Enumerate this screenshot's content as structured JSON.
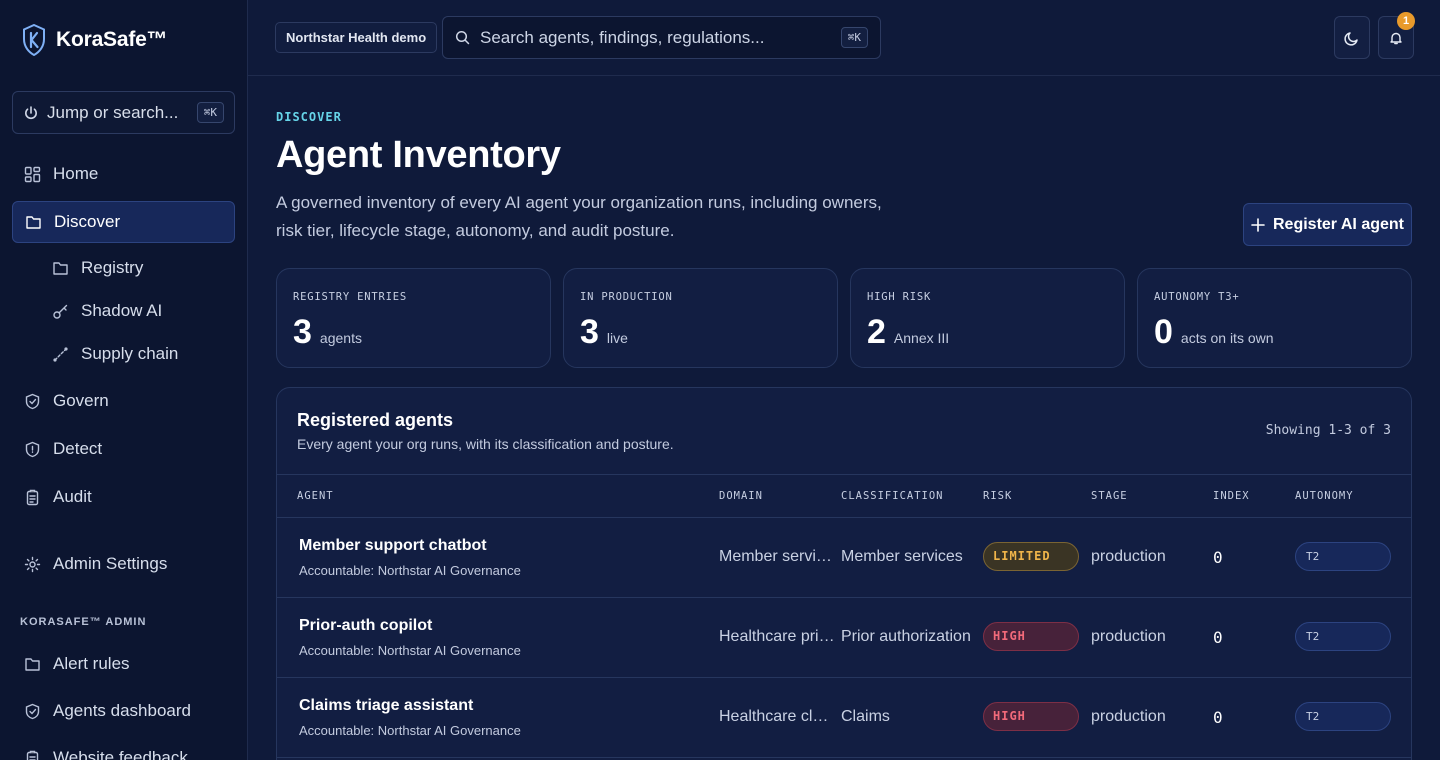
{
  "brand": {
    "name": "KoraSafe™"
  },
  "sidebar": {
    "jump_label": "Jump or search...",
    "jump_shortcut": "⌘K",
    "items": [
      {
        "label": "Home",
        "icon": "grid-icon"
      },
      {
        "label": "Discover",
        "icon": "folder-icon",
        "active": true
      },
      {
        "label": "Registry",
        "icon": "folder-icon",
        "sub": true
      },
      {
        "label": "Shadow AI",
        "icon": "key-icon",
        "sub": true
      },
      {
        "label": "Supply chain",
        "icon": "link-icon",
        "sub": true
      },
      {
        "label": "Govern",
        "icon": "shield-check-icon"
      },
      {
        "label": "Detect",
        "icon": "shield-icon"
      },
      {
        "label": "Audit",
        "icon": "clipboard-icon"
      },
      {
        "label": "Admin Settings",
        "icon": "gear-icon"
      }
    ],
    "admin_section_label": "KORASAFE™ ADMIN",
    "admin_items": [
      {
        "label": "Alert rules",
        "icon": "folder-icon"
      },
      {
        "label": "Agents dashboard",
        "icon": "shield-check-icon"
      },
      {
        "label": "Website feedback",
        "icon": "clipboard-icon"
      }
    ]
  },
  "topbar": {
    "org_label": "Northstar Health demo",
    "search_placeholder": "Search agents, findings, regulations...",
    "search_shortcut": "⌘K",
    "notification_count": "1"
  },
  "page": {
    "eyebrow": "DISCOVER",
    "title": "Agent Inventory",
    "description": "A governed inventory of every AI agent your organization runs, including owners, risk tier, lifecycle stage, autonomy, and audit posture.",
    "register_button": "Register AI agent"
  },
  "stats": [
    {
      "label": "REGISTRY ENTRIES",
      "value": "3",
      "unit": "agents"
    },
    {
      "label": "IN PRODUCTION",
      "value": "3",
      "unit": "live"
    },
    {
      "label": "HIGH RISK",
      "value": "2",
      "unit": "Annex III"
    },
    {
      "label": "AUTONOMY T3+",
      "value": "0",
      "unit": "acts on its own"
    }
  ],
  "table": {
    "title": "Registered agents",
    "subtitle": "Every agent your org runs, with its classification and posture.",
    "count": "Showing 1-3 of 3",
    "headers": {
      "agent": "AGENT",
      "domain": "DOMAIN",
      "classification": "CLASSIFICATION",
      "risk": "RISK",
      "stage": "STAGE",
      "index": "INDEX",
      "autonomy": "AUTONOMY"
    },
    "rows": [
      {
        "name": "Member support chatbot",
        "accountable": "Accountable: Northstar AI Governance",
        "domain": "Member services",
        "classification": "Member services",
        "risk": "LIMITED",
        "stage": "production",
        "index": "0",
        "autonomy": "T2"
      },
      {
        "name": "Prior-auth copilot",
        "accountable": "Accountable: Northstar AI Governance",
        "domain": "Healthcare prio...",
        "classification": "Prior authorization",
        "risk": "HIGH",
        "stage": "production",
        "index": "0",
        "autonomy": "T2"
      },
      {
        "name": "Claims triage assistant",
        "accountable": "Accountable: Northstar AI Governance",
        "domain": "Healthcare claims",
        "classification": "Claims",
        "risk": "HIGH",
        "stage": "production",
        "index": "0",
        "autonomy": "T2"
      }
    ]
  },
  "colors": {
    "background": "#0f1a3a",
    "sidebar": "#0c1530",
    "accent": "#66d4e8",
    "risk_limited": "#f0b54a",
    "risk_high": "#f26a7a",
    "badge": "#e89a2b"
  }
}
